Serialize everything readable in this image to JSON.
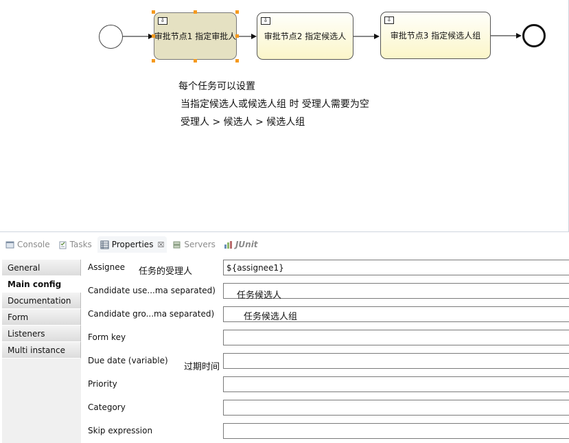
{
  "diagram": {
    "tasks": [
      {
        "label": "审批节点1 指定审批人",
        "selected": true
      },
      {
        "label": "审批节点2 指定候选人",
        "selected": false
      },
      {
        "label": "审批节点3 指定候选人组",
        "selected": false
      }
    ],
    "task_marker": "⇩",
    "notes": [
      "每个任务可以设置",
      "当指定候选人或候选人组 时 受理人需要为空",
      "受理人 > 候选人 > 候选人组"
    ]
  },
  "tabs": [
    {
      "label": "Console",
      "icon": "console-icon",
      "active": false
    },
    {
      "label": "Tasks",
      "icon": "tasks-icon",
      "active": false
    },
    {
      "label": "Properties",
      "icon": "properties-icon",
      "active": true,
      "close": "☒"
    },
    {
      "label": "Servers",
      "icon": "servers-icon",
      "active": false
    },
    {
      "label": "JUnit",
      "icon": "junit-icon",
      "active": false
    }
  ],
  "sidebar": {
    "items": [
      {
        "label": "General",
        "active": false
      },
      {
        "label": "Main config",
        "active": true
      },
      {
        "label": "Documentation",
        "active": false
      },
      {
        "label": "Form",
        "active": false
      },
      {
        "label": "Listeners",
        "active": false
      },
      {
        "label": "Multi instance",
        "active": false
      }
    ]
  },
  "fields": [
    {
      "label": "Assignee",
      "value": "${assignee1}"
    },
    {
      "label": "Candidate use...ma separated)",
      "value": ""
    },
    {
      "label": "Candidate gro...ma separated)",
      "value": ""
    },
    {
      "label": "Form key",
      "value": ""
    },
    {
      "label": "Due date (variable)",
      "value": ""
    },
    {
      "label": "Priority",
      "value": ""
    },
    {
      "label": "Category",
      "value": ""
    },
    {
      "label": "Skip expression",
      "value": ""
    }
  ],
  "annotations": {
    "assignee": "任务的受理人",
    "candidate_users": "任务候选人",
    "candidate_groups": "任务候选人组",
    "due_date": "过期时间"
  }
}
